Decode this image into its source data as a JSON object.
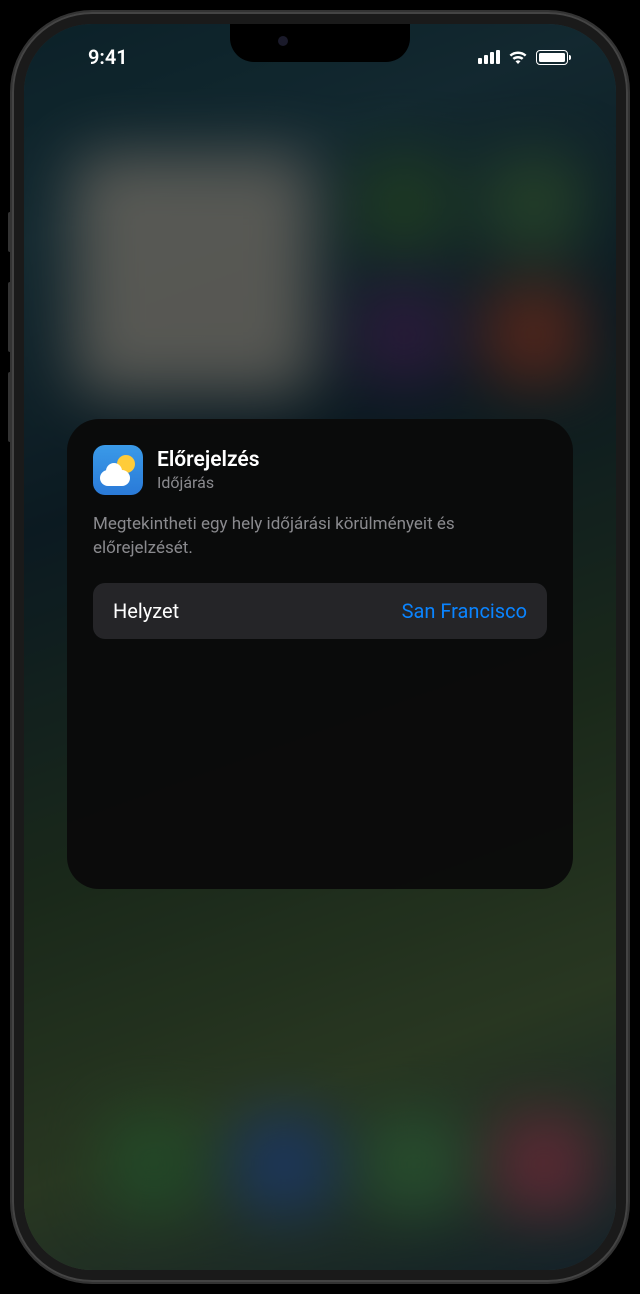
{
  "status_bar": {
    "time": "9:41"
  },
  "popup": {
    "title": "Előrejelzés",
    "app_name": "Időjárás",
    "description": "Megtekintheti egy hely időjárási körülményeit és előrejelzését.",
    "row": {
      "label": "Helyzet",
      "value": "San Francisco"
    }
  }
}
